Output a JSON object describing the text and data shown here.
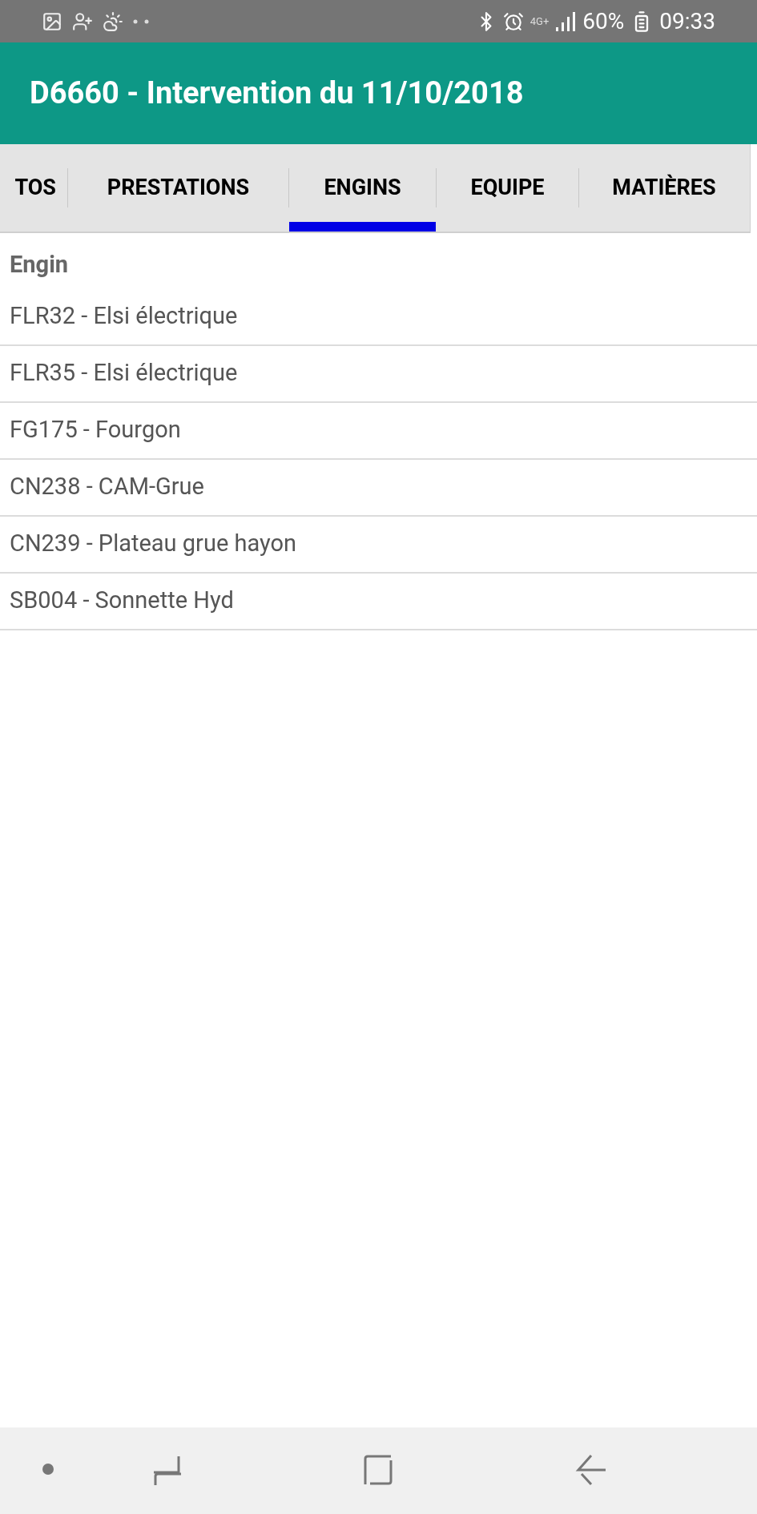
{
  "status_bar": {
    "network": "4G+",
    "battery": "60%",
    "time": "09:33"
  },
  "app_bar": {
    "title": "D6660 - Intervention du 11/10/2018"
  },
  "tabs": [
    {
      "label": "TOS",
      "selected": false
    },
    {
      "label": "PRESTATIONS",
      "selected": false
    },
    {
      "label": "ENGINS",
      "selected": true
    },
    {
      "label": "EQUIPE",
      "selected": false
    },
    {
      "label": "MATIÈRES",
      "selected": false
    }
  ],
  "list": {
    "header": "Engin",
    "rows": [
      "FLR32 - Elsi électrique",
      "FLR35 - Elsi électrique",
      "FG175 - Fourgon",
      "CN238 - CAM-Grue",
      "CN239 - Plateau grue hayon",
      "SB004 - Sonnette Hyd"
    ]
  }
}
